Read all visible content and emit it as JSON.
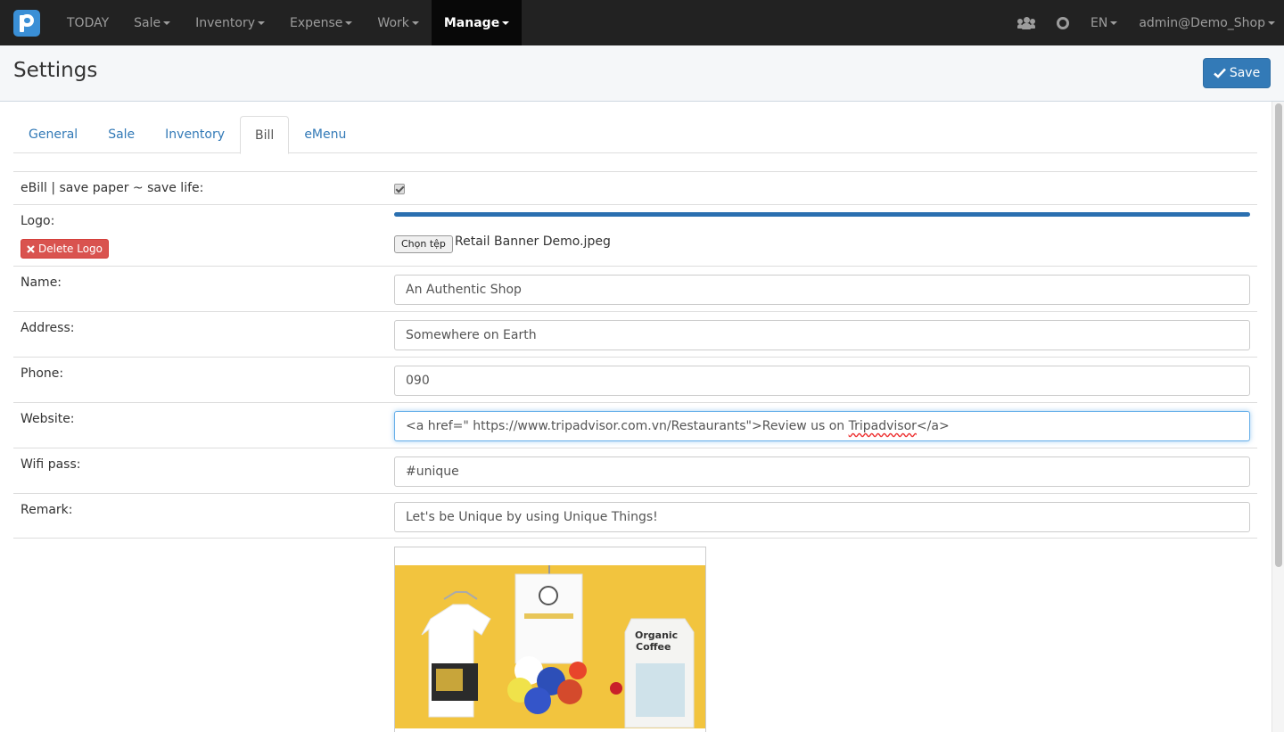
{
  "nav": {
    "items": [
      {
        "label": "TODAY",
        "caret": false
      },
      {
        "label": "Sale",
        "caret": true
      },
      {
        "label": "Inventory",
        "caret": true
      },
      {
        "label": "Expense",
        "caret": true
      },
      {
        "label": "Work",
        "caret": true
      },
      {
        "label": "Manage",
        "caret": true,
        "active": true
      }
    ],
    "right": {
      "language": "EN",
      "user": "admin@Demo_Shop"
    },
    "icons": [
      "users-icon",
      "lifebuoy-icon"
    ]
  },
  "header": {
    "title": "Settings",
    "save_label": "Save",
    "save_icon": "check-icon"
  },
  "tabs": [
    {
      "label": "General"
    },
    {
      "label": "Sale"
    },
    {
      "label": "Inventory"
    },
    {
      "label": "Bill",
      "active": true
    },
    {
      "label": "eMenu"
    }
  ],
  "form": {
    "ebill": {
      "label": "eBill | save paper ~ save life:",
      "checked": true
    },
    "logo": {
      "label": "Logo:",
      "delete_label": "Delete Logo",
      "delete_icon": "times-icon",
      "upload_progress_pct": 100,
      "file_button": "Chọn tệp",
      "file_name": "Retail Banner Demo.jpeg"
    },
    "name": {
      "label": "Name:",
      "value": "An Authentic Shop"
    },
    "address": {
      "label": "Address:",
      "value": "Somewhere on Earth"
    },
    "phone": {
      "label": "Phone:",
      "value": "090"
    },
    "website": {
      "label": "Website:",
      "value_before": "<a href=\" https://www.tripadvisor.com.vn/Restaurants\">Review us on ",
      "value_flagged": "Tripadvisor",
      "value_after": "</a>"
    },
    "wifi": {
      "label": "Wifi pass:",
      "value": "#unique"
    },
    "remark": {
      "label": "Remark:",
      "value": "Let's be Unique by using Unique Things!"
    }
  },
  "preview": {
    "banner_text": "Organic\nCoffee",
    "background_color": "#f2c43e"
  },
  "colors": {
    "navbar_bg": "#222222",
    "primary": "#337ab7",
    "danger": "#d9534f",
    "brand": "#3a8fd6"
  }
}
